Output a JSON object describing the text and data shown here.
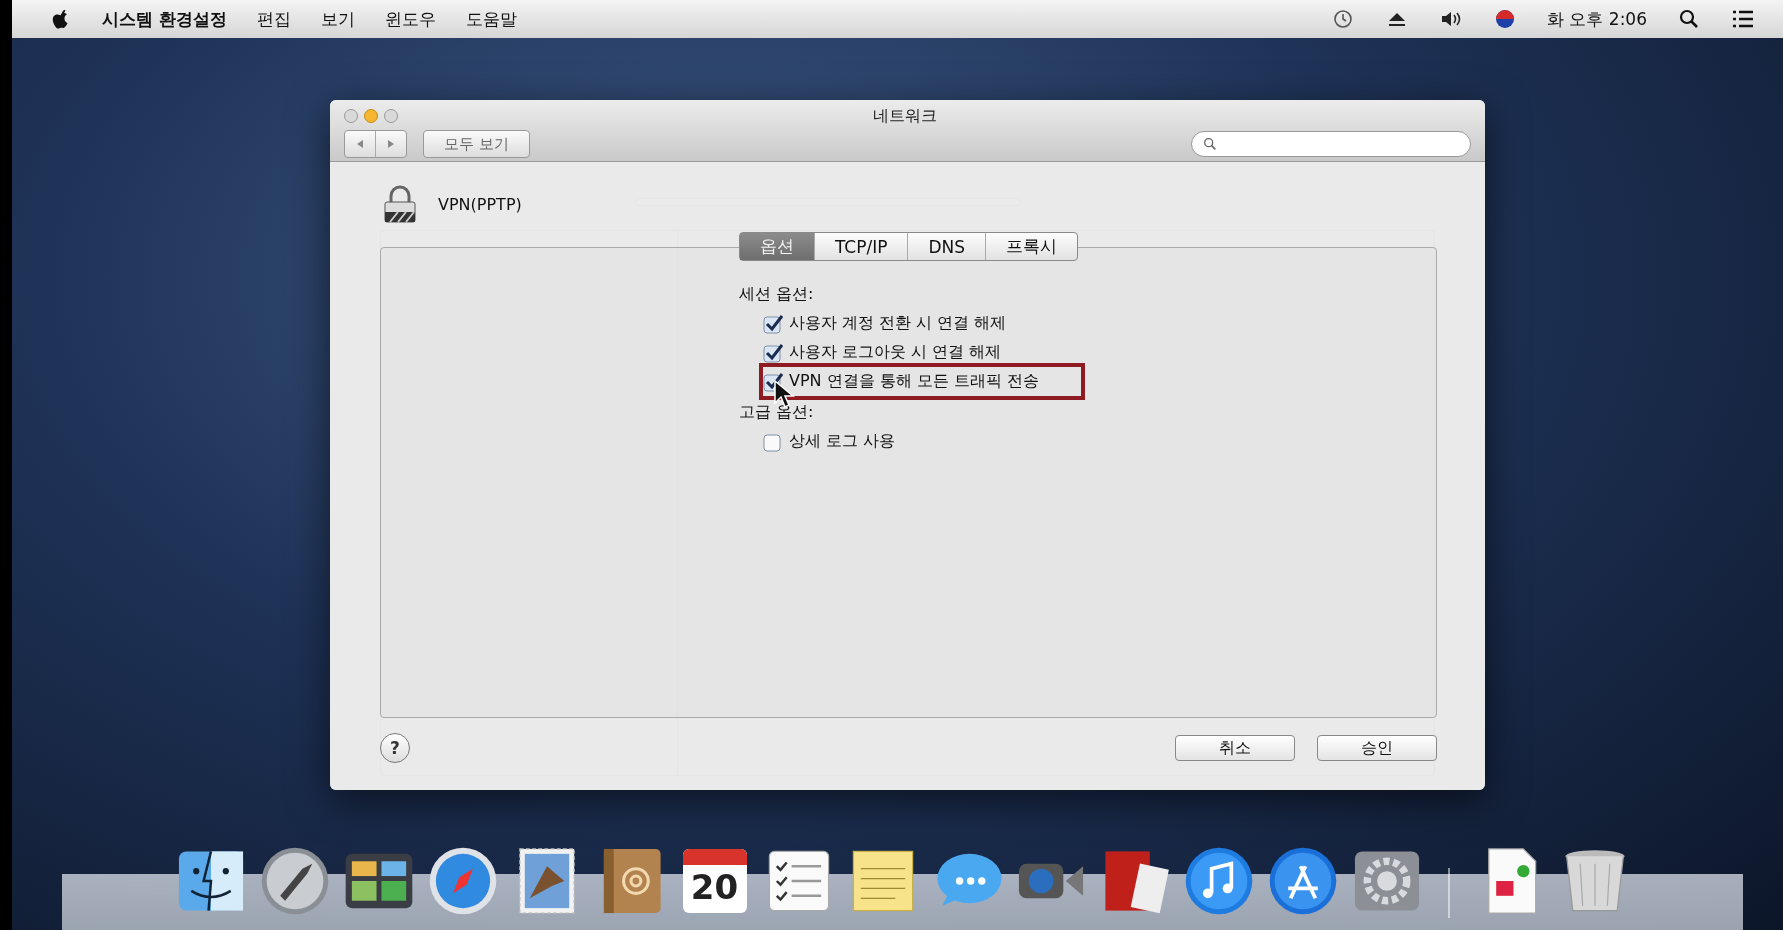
{
  "menu_bar": {
    "app_name": "시스템 환경설정",
    "menus": [
      "편집",
      "보기",
      "윈도우",
      "도움말"
    ],
    "clock": "화 오후 2:06"
  },
  "window": {
    "title": "네트워크",
    "show_all_button": "모두 보기"
  },
  "sheet": {
    "service_name": "VPN(PPTP)",
    "tabs": [
      {
        "label": "옵션",
        "selected": true
      },
      {
        "label": "TCP/IP",
        "selected": false
      },
      {
        "label": "DNS",
        "selected": false
      },
      {
        "label": "프록시",
        "selected": false
      }
    ],
    "sections": [
      {
        "title": "세션 옵션:",
        "options": [
          {
            "label": "사용자 계정 전환 시 연결 해제",
            "checked": true,
            "highlighted": false
          },
          {
            "label": "사용자 로그아웃 시 연결 해제",
            "checked": true,
            "highlighted": false
          },
          {
            "label": "VPN 연결을 통해 모든 트래픽 전송",
            "checked": true,
            "highlighted": true
          }
        ]
      },
      {
        "title": "고급 옵션:",
        "options": [
          {
            "label": "상세 로그 사용",
            "checked": false,
            "highlighted": false
          }
        ]
      }
    ],
    "help_button": "?",
    "buttons": [
      "취소",
      "승인"
    ]
  },
  "dock": {
    "apps": [
      {
        "kind": "finder"
      },
      {
        "kind": "launchpad"
      },
      {
        "kind": "mission"
      },
      {
        "kind": "safari"
      },
      {
        "kind": "mail"
      },
      {
        "kind": "contacts"
      },
      {
        "kind": "calendar",
        "day": "20"
      },
      {
        "kind": "reminders"
      },
      {
        "kind": "notes"
      },
      {
        "kind": "messages"
      },
      {
        "kind": "facetime"
      },
      {
        "kind": "photobooth"
      },
      {
        "kind": "itunes"
      },
      {
        "kind": "appstore"
      },
      {
        "kind": "preferences"
      },
      {
        "kind": "separator"
      },
      {
        "kind": "document"
      },
      {
        "kind": "trash"
      }
    ]
  }
}
